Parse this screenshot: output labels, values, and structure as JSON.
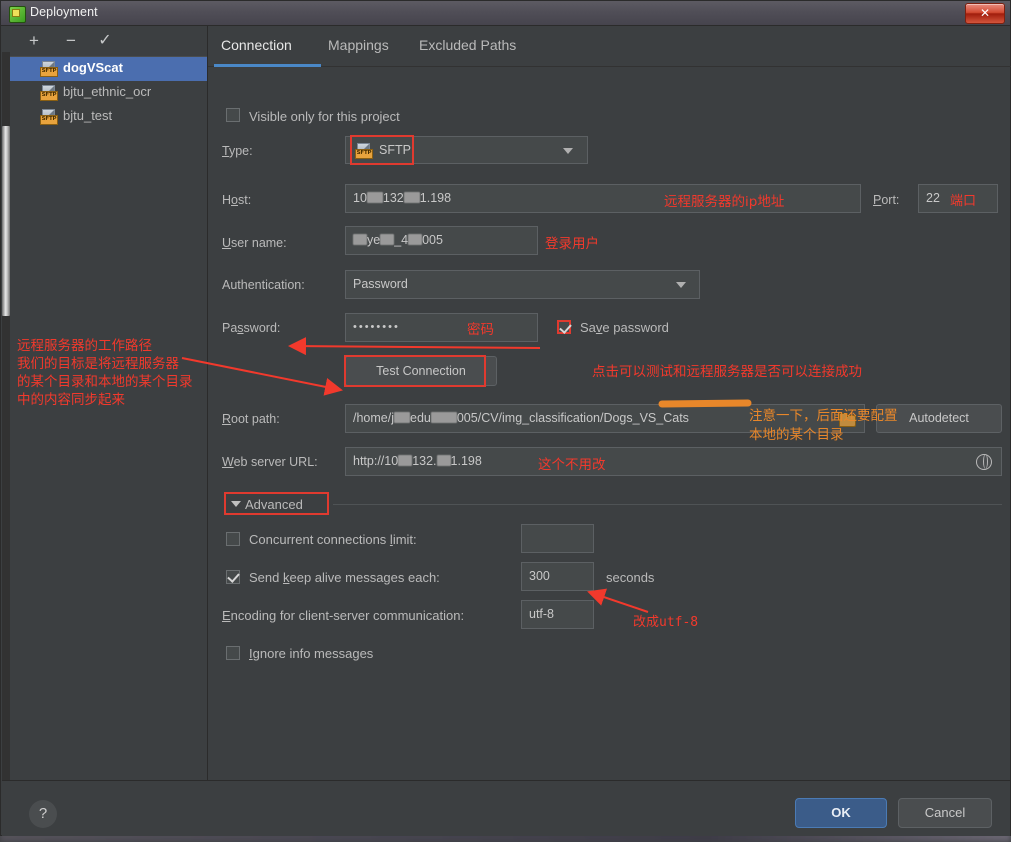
{
  "window": {
    "title": "Deployment",
    "close_label": "✕",
    "app_icon": "deployment-icon"
  },
  "sidebar": {
    "toolbar": {
      "add": "+",
      "remove": "−",
      "check": "✓"
    },
    "items": [
      {
        "label": "dogVScat",
        "icon": "sftp-server-icon",
        "selected": true
      },
      {
        "label": "bjtu_ethnic_ocr",
        "icon": "sftp-server-icon",
        "selected": false
      },
      {
        "label": "bjtu_test",
        "icon": "sftp-server-icon",
        "selected": false
      }
    ]
  },
  "tabs": [
    {
      "label": "Connection",
      "active": true
    },
    {
      "label": "Mappings",
      "active": false
    },
    {
      "label": "Excluded Paths",
      "active": false
    }
  ],
  "form": {
    "visible_only_label": "Visible only for this project",
    "visible_only_checked": false,
    "type_label": "Type:",
    "type_value": "SFTP",
    "host_label": "Host:",
    "host_value_pre": "10",
    "host_value_mid": "132",
    "host_value_post": "1.198",
    "port_label": "Port:",
    "port_value": "22",
    "username_label": "User name:",
    "username_part1": "ye",
    "username_part2": "_4",
    "username_part3": "005",
    "auth_label": "Authentication:",
    "auth_value": "Password",
    "password_label": "Password:",
    "password_value": "••••••••",
    "save_password_label": "Save password",
    "save_password_checked": true,
    "test_connection_label": "Test Connection",
    "root_path_label": "Root path:",
    "root_path_pre": "/home/j",
    "root_path_mid": "edu",
    "root_path_post": "005/CV/img_classification/Dogs_VS_Cats",
    "autodetect_label": "Autodetect",
    "web_url_label": "Web server URL:",
    "web_url_pre": "http://10",
    "web_url_mid": "132.",
    "web_url_post": "1.198"
  },
  "advanced": {
    "section_label": "Advanced",
    "concurrent_label": "Concurrent connections limit:",
    "concurrent_checked": false,
    "concurrent_value": "",
    "keepalive_label": "Send keep alive messages each:",
    "keepalive_checked": true,
    "keepalive_value": "300",
    "keepalive_unit": "seconds",
    "encoding_label": "Encoding for client-server communication:",
    "encoding_value": "utf-8",
    "ignore_info_label": "Ignore info messages",
    "ignore_info_checked": false
  },
  "footer": {
    "help_label": "?",
    "ok_label": "OK",
    "cancel_label": "Cancel"
  },
  "annotations": {
    "host_note": "远程服务器的ip地址",
    "port_note": "端口",
    "username_note": "登录用户",
    "password_note": "密码",
    "test_connection_note": "点击可以测试和远程服务器是否可以连接成功",
    "root_path_note_line1": "远程服务器的工作路径",
    "root_path_note_line2": "我们的目标是将远程服务器",
    "root_path_note_line3": "的某个目录和本地的某个目录",
    "root_path_note_line4": "中的内容同步起来",
    "orange_note_line1": "注意一下，后面还要配置",
    "orange_note_line2": "本地的某个目录",
    "web_url_note": "这个不用改",
    "encoding_note": "改成utf-8"
  },
  "colors": {
    "accent_blue": "#4b6eaf",
    "tab_underline": "#4a88c7",
    "annotation_red": "#f2392c",
    "annotation_orange": "#e8872a",
    "dialog_bg": "#3c3f41",
    "field_bg": "#45494a",
    "ok_button": "#3b5c89"
  }
}
